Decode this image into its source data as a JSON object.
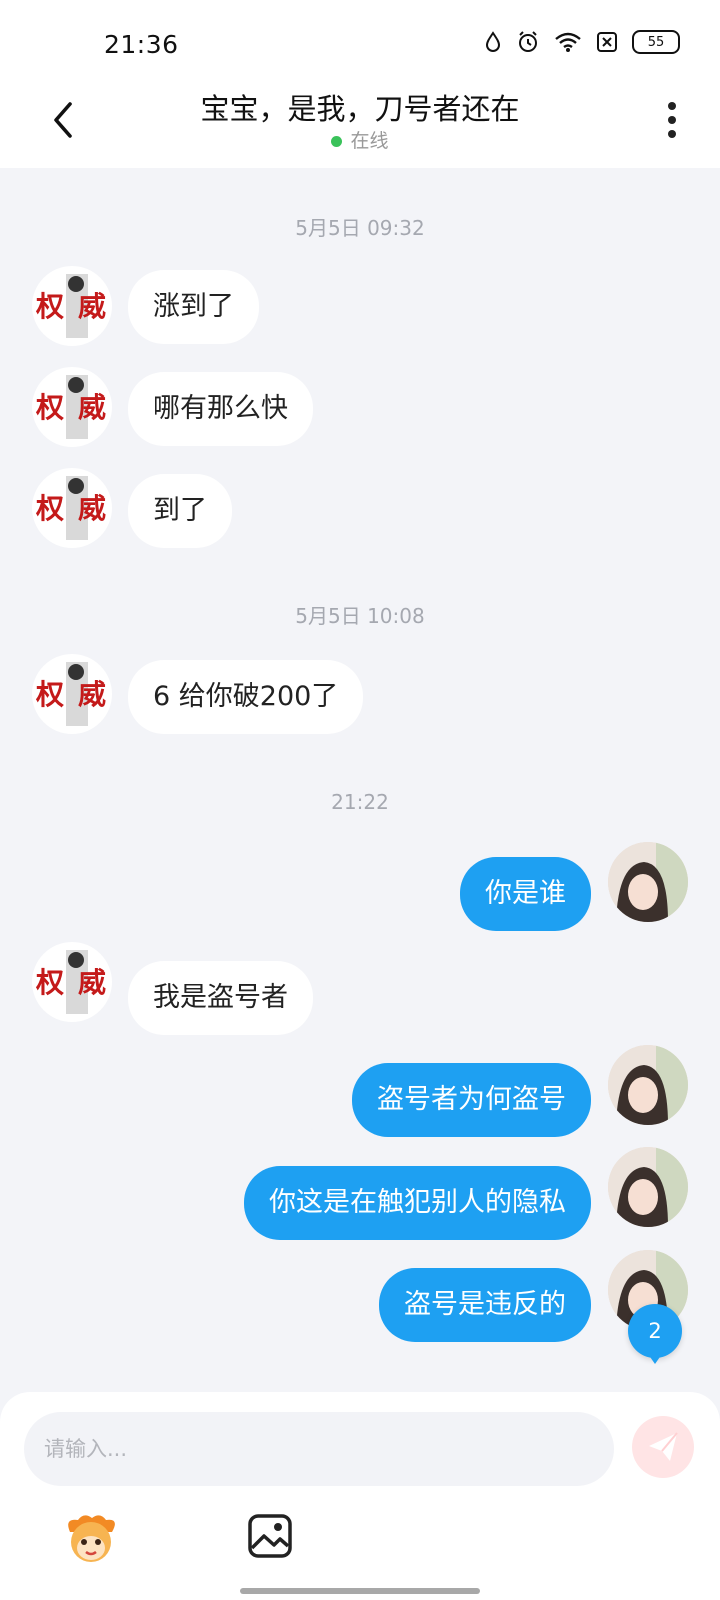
{
  "status_bar": {
    "time": "21:36",
    "battery": "55"
  },
  "header": {
    "title": "宝宝，是我，刀号者还在",
    "status": "在线"
  },
  "timestamps": [
    "5月5日 09:32",
    "5月5日 10:08",
    "21:22"
  ],
  "messages": [
    {
      "side": "incoming",
      "text": "涨到了"
    },
    {
      "side": "incoming",
      "text": "哪有那么快"
    },
    {
      "side": "incoming",
      "text": "到了"
    },
    {
      "side": "incoming",
      "text": "6 给你破200了"
    },
    {
      "side": "outgoing",
      "text": "你是谁"
    },
    {
      "side": "incoming",
      "text": "我是盗号者"
    },
    {
      "side": "outgoing",
      "text": "盗号者为何盗号"
    },
    {
      "side": "outgoing",
      "text": "你这是在触犯别人的隐私"
    },
    {
      "side": "outgoing",
      "text": "盗号是违反的"
    }
  ],
  "unread_count": "2",
  "input": {
    "placeholder": "请输入..."
  },
  "colors": {
    "outgoing_bubble": "#1ea0f2",
    "incoming_bubble": "#ffffff",
    "background": "#f3f4f8",
    "online_dot": "#3ac25a",
    "avatar_text": "#c41a1a"
  },
  "icons": [
    "back-arrow-icon",
    "more-vertical-icon",
    "send-icon",
    "emoji-mascot-icon",
    "image-icon"
  ]
}
